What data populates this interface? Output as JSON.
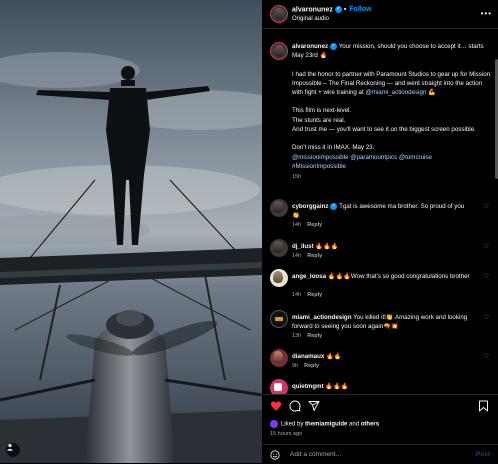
{
  "header": {
    "username": "alvaronunez",
    "follow_label": "Follow",
    "audio": "Original audio"
  },
  "caption": {
    "username": "alvaronunez",
    "lead": "Your mission, should you choose to accept it… starts May 23rd",
    "lead_emoji": "🔥",
    "para2_a": "I had the honor to partner with Paramount Studios to gear up for Mission: Impossible – The Final Reckoning — and went straight into the action with fight + wire training at",
    "para2_mention": "@miami_actiondesign",
    "para2_emoji": "💪",
    "line1": "This film is next-level.",
    "line2": "The stunts are real.",
    "line3": "And trust me — you'll want to see it on the biggest screen possible.",
    "line4": "Don't miss it in IMAX. May 23.",
    "mention1": "@missionimpossible",
    "mention2": "@paramountpics",
    "mention3": "@tomcruise",
    "hashtag": "#MissionImpossible",
    "time": "15h"
  },
  "comments": [
    {
      "user": "cyborggainz",
      "verified": true,
      "text": "Tgat is awesome ma brother. So proud of you 👏",
      "time": "14h",
      "reply": "Reply"
    },
    {
      "user": "dj_ilust",
      "verified": false,
      "text": "🔥🔥🔥",
      "time": "14h",
      "reply": "Reply"
    },
    {
      "user": "ange_loosa",
      "verified": false,
      "text": "🔥🔥🔥Wow that's so good congratulations brother",
      "time": "14h",
      "reply": "Reply"
    },
    {
      "user": "miami_actiondesign",
      "verified": false,
      "text": "You killed it!👏 Amazing work and looking forward to seeing you soon again🔫💥",
      "time": "13h",
      "reply": "Reply"
    },
    {
      "user": "dianamaux",
      "verified": false,
      "text": "🔥🔥",
      "time": "9h",
      "reply": "Reply"
    },
    {
      "user": "quietmgmt",
      "verified": false,
      "text": "🔥🔥🔥",
      "time": "",
      "reply": ""
    }
  ],
  "actions": {
    "liked_prefix": "Liked by",
    "liked_user": "themiamiguide",
    "liked_and": "and",
    "liked_others": "others",
    "post_time": "15 hours ago"
  },
  "composer": {
    "placeholder": "Add a comment…",
    "post_label": "Post"
  }
}
